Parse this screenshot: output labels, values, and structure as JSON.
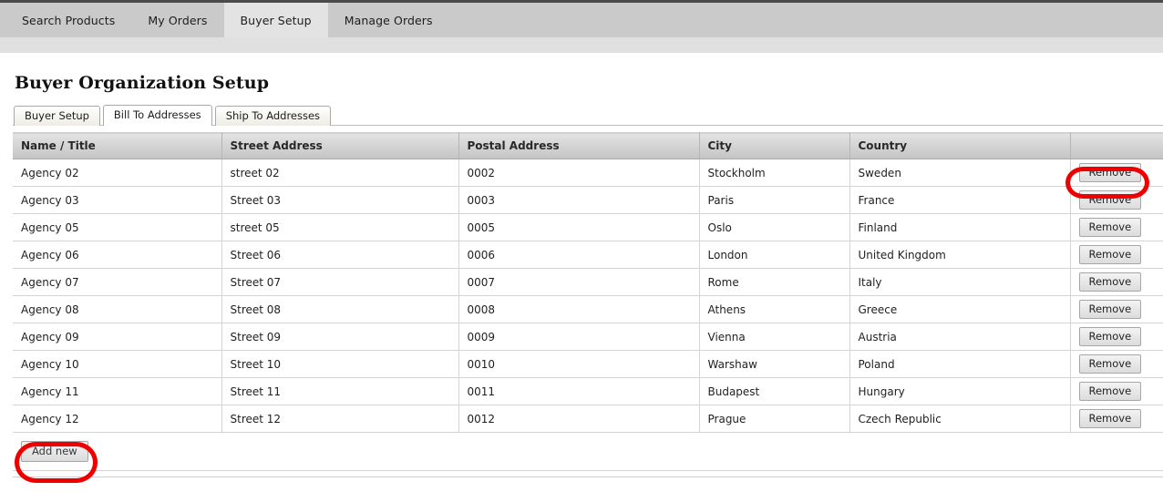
{
  "nav": {
    "items": [
      {
        "label": "Search Products",
        "active": false
      },
      {
        "label": "My Orders",
        "active": false
      },
      {
        "label": "Buyer Setup",
        "active": true
      },
      {
        "label": "Manage Orders",
        "active": false
      }
    ]
  },
  "page": {
    "title": "Buyer Organization Setup"
  },
  "subtabs": {
    "items": [
      {
        "label": "Buyer Setup",
        "active": false
      },
      {
        "label": "Bill To Addresses",
        "active": true
      },
      {
        "label": "Ship To Addresses",
        "active": false
      }
    ]
  },
  "table": {
    "columns": [
      "Name / Title",
      "Street Address",
      "Postal Address",
      "City",
      "Country",
      ""
    ],
    "row_action_label": "Remove",
    "rows": [
      {
        "name": "Agency 02",
        "street": "street 02",
        "postal": "0002",
        "city": "Stockholm",
        "country": "Sweden",
        "action": "Remove"
      },
      {
        "name": "Agency 03",
        "street": "Street 03",
        "postal": "0003",
        "city": "Paris",
        "country": "France",
        "action": "Remove"
      },
      {
        "name": "Agency 05",
        "street": "street 05",
        "postal": "0005",
        "city": "Oslo",
        "country": "Finland",
        "action": "Remove"
      },
      {
        "name": "Agency 06",
        "street": "Street 06",
        "postal": "0006",
        "city": "London",
        "country": "United Kingdom",
        "action": "Remove"
      },
      {
        "name": "Agency 07",
        "street": "Street 07",
        "postal": "0007",
        "city": "Rome",
        "country": "Italy",
        "action": "Remove"
      },
      {
        "name": "Agency 08",
        "street": "Street 08",
        "postal": "0008",
        "city": "Athens",
        "country": "Greece",
        "action": "Remove"
      },
      {
        "name": "Agency 09",
        "street": "Street 09",
        "postal": "0009",
        "city": "Vienna",
        "country": "Austria",
        "action": "Remove"
      },
      {
        "name": "Agency 10",
        "street": "Street 10",
        "postal": "0010",
        "city": "Warshaw",
        "country": "Poland",
        "action": "Remove"
      },
      {
        "name": "Agency 11",
        "street": "Street 11",
        "postal": "0011",
        "city": "Budapest",
        "country": "Hungary",
        "action": "Remove"
      },
      {
        "name": "Agency 12",
        "street": "Street 12",
        "postal": "0012",
        "city": "Prague",
        "country": "Czech Republic",
        "action": "Remove"
      }
    ]
  },
  "footer": {
    "add_new_label": "Add new"
  },
  "annotations": {
    "color": "#ee0000",
    "highlights": [
      {
        "target": "first-remove-button",
        "shape": "ellipse"
      },
      {
        "target": "add-new-button",
        "shape": "ellipse"
      }
    ]
  }
}
